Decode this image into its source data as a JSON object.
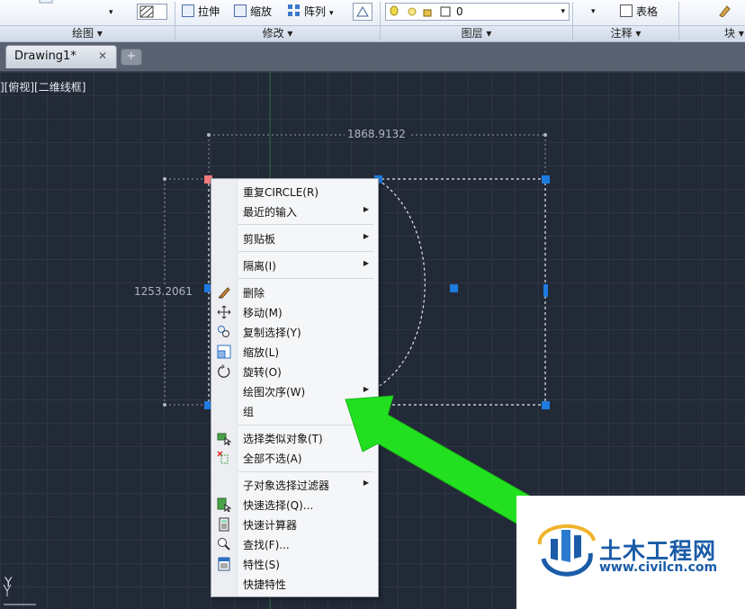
{
  "ribbon": {
    "panels": [
      {
        "name": "draw",
        "title": "绘图 ▾"
      },
      {
        "name": "modify",
        "title": "修改 ▾"
      },
      {
        "name": "layers",
        "title": "图层 ▾"
      },
      {
        "name": "annotation",
        "title": "注释 ▾"
      },
      {
        "name": "block",
        "title": "块 ▾"
      }
    ],
    "stretch_label": "拉伸",
    "scale_label": "缩放",
    "array_label": "阵列",
    "array_arrow": "▾",
    "layer_value": "0",
    "table_label": "表格",
    "small_arrow": "▾"
  },
  "tabs": {
    "drawing_title": "Drawing1*",
    "close_glyph": "✕",
    "new_tab_glyph": "+"
  },
  "viewport": {
    "view_label": "][俯视][二维线框]",
    "axis_label": "Y",
    "dim_width": "1868.9132",
    "dim_height": "1253.2061"
  },
  "context_menu": {
    "items": [
      {
        "label": "重复CIRCLE(R)",
        "submenu": false,
        "icon": ""
      },
      {
        "label": "最近的输入",
        "submenu": true,
        "icon": ""
      },
      {
        "label": "剪贴板",
        "submenu": true,
        "icon": ""
      },
      {
        "label": "隔离(I)",
        "submenu": true,
        "icon": ""
      },
      {
        "label": "删除",
        "submenu": false,
        "icon": "eraser-icon"
      },
      {
        "label": "移动(M)",
        "submenu": false,
        "icon": "move-icon"
      },
      {
        "label": "复制选择(Y)",
        "submenu": false,
        "icon": "copy-icon"
      },
      {
        "label": "缩放(L)",
        "submenu": false,
        "icon": "scale-icon"
      },
      {
        "label": "旋转(O)",
        "submenu": false,
        "icon": "rotate-icon"
      },
      {
        "label": "绘图次序(W)",
        "submenu": true,
        "icon": ""
      },
      {
        "label": "组",
        "submenu": false,
        "icon": ""
      },
      {
        "label": "选择类似对象(T)",
        "submenu": false,
        "icon": "select-similar-icon"
      },
      {
        "label": "全部不选(A)",
        "submenu": false,
        "icon": "deselect-icon"
      },
      {
        "label": "子对象选择过滤器",
        "submenu": true,
        "icon": ""
      },
      {
        "label": "快速选择(Q)...",
        "submenu": false,
        "icon": "quick-select-icon"
      },
      {
        "label": "快速计算器",
        "submenu": false,
        "icon": "calculator-icon"
      },
      {
        "label": "查找(F)...",
        "submenu": false,
        "icon": "find-icon"
      },
      {
        "label": "特性(S)",
        "submenu": false,
        "icon": "properties-icon"
      },
      {
        "label": "快捷特性",
        "submenu": false,
        "icon": ""
      }
    ],
    "submenu_arrow": "▶"
  },
  "watermark": {
    "name": "土木工程网",
    "url": "www.civilcn.com"
  },
  "colors": {
    "canvas": "#232a37",
    "grip": "#1e7be0",
    "arrow": "#22e01f",
    "watermark": "#1a5ca8"
  }
}
